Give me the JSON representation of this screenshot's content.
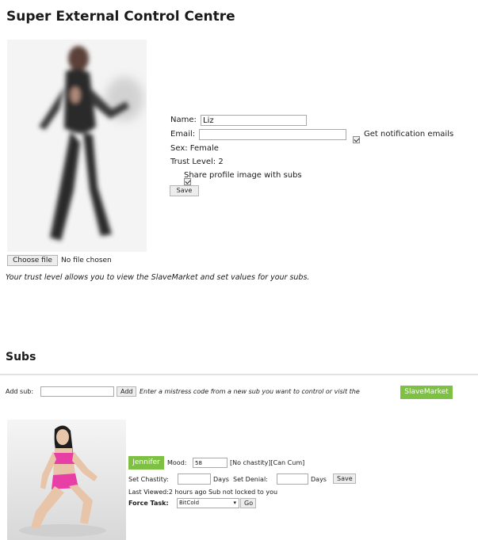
{
  "page_title": "Super External Control Centre",
  "profile": {
    "name_label": "Name:",
    "name_value": "Liz",
    "email_label": "Email:",
    "email_value": "",
    "notify_label": "Get notification emails",
    "sex_text": "Sex: Female",
    "trust_text": "Trust Level: 2",
    "share_label": "Share profile image with subs",
    "save_label": "Save",
    "choose_file_label": "Choose file",
    "no_file_text": "No file chosen",
    "trust_info": "Your trust level allows you to view the SlaveMarket and set values for your subs."
  },
  "subs": {
    "heading": "Subs",
    "add_sub_label": "Add sub:",
    "add_button": "Add",
    "instruction": "Enter a mistress code from a new sub you want to control or visit the",
    "slavemarket_button": "SlaveMarket",
    "items": [
      {
        "name": "Jennifer",
        "mood_label": "Mood:",
        "mood_value": "58",
        "status_text": "[No chastity][Can Cum]",
        "set_chastity_label": "Set Chastity:",
        "days_label_1": "Days",
        "set_denial_label": "Set Denial:",
        "days_label_2": "Days",
        "save_label": "Save",
        "last_viewed_text": "Last Viewed:2 hours ago Sub not locked to you",
        "force_task_label": "Force Task:",
        "force_task_value": "BitCold",
        "go_label": "Go"
      }
    ]
  }
}
